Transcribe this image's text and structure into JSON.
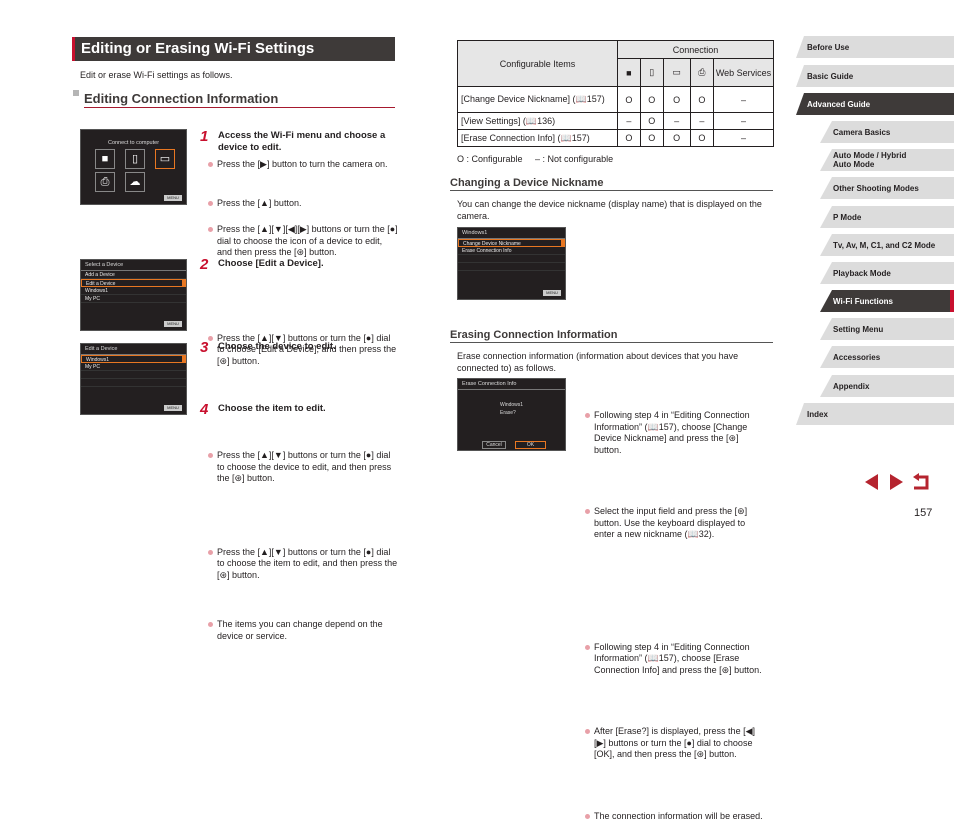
{
  "page": {
    "title": "Editing or Erasing Wi-Fi Settings",
    "intro": "Edit or erase Wi-Fi settings as follows.",
    "section_title": "Editing Connection Information",
    "page_number": "157"
  },
  "screens": {
    "s1": {
      "title": "Connect to computer",
      "icons": [
        "camera-icon",
        "smartphone-icon",
        "computer-icon",
        "printer-icon",
        "cloud-icon"
      ],
      "selected": "computer-icon",
      "menu": "MENU"
    },
    "s2": {
      "title": "Select a Device",
      "items": [
        "Add a Device",
        "Edit a Device",
        "Windows1",
        "My PC"
      ],
      "selected_index": 1,
      "menu": "MENU"
    },
    "s3": {
      "title": "Edit a Device",
      "items": [
        "Windows1",
        "My PC"
      ],
      "selected_index": 0,
      "menu": "MENU"
    },
    "s4": {
      "title": "Windows1",
      "items": [
        "Change Device Nickname",
        "Erase Connection Info"
      ],
      "selected_index": 0,
      "menu": "MENU"
    },
    "s5": {
      "title": "Erase Connection Info",
      "line1": "Windows1",
      "line2": "Erase?",
      "cancel": "Cancel",
      "ok": "OK"
    }
  },
  "steps": [
    {
      "num": "1",
      "title": "Access the Wi-Fi menu and choose a device to edit.",
      "bullets": [
        "Press the [▶] button to turn the camera on.",
        "Press the [▲] button.",
        "Press the [▲][▼][◀][▶] buttons or turn the [●] dial to choose the icon of a device to edit, and then press the [⊛] button."
      ]
    },
    {
      "num": "2",
      "title": "Choose [Edit a Device].",
      "bullets": [
        "Press the [▲][▼] buttons or turn the [●] dial to choose [Edit a Device], and then press the [⊛] button."
      ]
    },
    {
      "num": "3",
      "title": "Choose the device to edit.",
      "bullets": [
        "Press the [▲][▼] buttons or turn the [●] dial to choose the device to edit, and then press the [⊛] button."
      ]
    },
    {
      "num": "4",
      "title": "Choose the item to edit.",
      "bullets": [
        "Press the [▲][▼] buttons or turn the [●] dial to choose the item to edit, and then press the [⊛] button.",
        "The items you can change depend on the device or service."
      ]
    }
  ],
  "table": {
    "col_header": "Configurable Items",
    "group_header": "Connection",
    "columns": [
      "■",
      "▯",
      "▭",
      "⎙",
      "Web Services"
    ],
    "rows": [
      {
        "label": "[Change Device Nickname] (📖157)",
        "values": [
          "O",
          "O",
          "O",
          "O",
          "–"
        ]
      },
      {
        "label": "[View Settings] (📖136)",
        "values": [
          "–",
          "O",
          "–",
          "–",
          "–"
        ]
      },
      {
        "label": "[Erase Connection Info] (📖157)",
        "values": [
          "O",
          "O",
          "O",
          "O",
          "–"
        ]
      }
    ],
    "legend": "O : Configurable     – : Not configurable"
  },
  "nickname": {
    "title": "Changing a Device Nickname",
    "intro": "You can change the device nickname (display name) that is displayed on the camera.",
    "bullets": [
      "Following step 4 in “Editing Connection Information” (📖157), choose [Change Device Nickname] and press the [⊛] button.",
      "Select the input field and press the [⊛] button. Use the keyboard displayed to enter a new nickname (📖32)."
    ]
  },
  "erase": {
    "title": "Erasing Connection Information",
    "intro": "Erase connection information (information about devices that you have connected to) as follows.",
    "bullets": [
      "Following step 4 in “Editing Connection Information” (📖157), choose [Erase Connection Info] and press the [⊛] button.",
      "After [Erase?] is displayed, press the [◀][▶] buttons or turn the [●] dial to choose [OK], and then press the [⊛] button.",
      "The connection information will be erased."
    ]
  },
  "sidebar": {
    "items": [
      {
        "label": "Before Use",
        "level": 0
      },
      {
        "label": "Basic Guide",
        "level": 0
      },
      {
        "label": "Advanced Guide",
        "level": 0,
        "active": true
      },
      {
        "label": "Camera Basics",
        "level": 1
      },
      {
        "label": "Auto Mode / Hybrid Auto Mode",
        "level": 1
      },
      {
        "label": "Other Shooting Modes",
        "level": 1
      },
      {
        "label": "P Mode",
        "level": 1
      },
      {
        "label": "Tv, Av, M, C1, and C2 Mode",
        "level": 1
      },
      {
        "label": "Playback Mode",
        "level": 1
      },
      {
        "label": "Wi-Fi Functions",
        "level": 1,
        "active": true,
        "current": true
      },
      {
        "label": "Setting Menu",
        "level": 1
      },
      {
        "label": "Accessories",
        "level": 1
      },
      {
        "label": "Appendix",
        "level": 1
      },
      {
        "label": "Index",
        "level": 0
      }
    ]
  },
  "nav": {
    "prev": "previous-page",
    "next": "next-page",
    "back": "return"
  },
  "colors": {
    "accent": "#c8102e",
    "dark": "#3e3a39",
    "highlight": "#e87722"
  }
}
